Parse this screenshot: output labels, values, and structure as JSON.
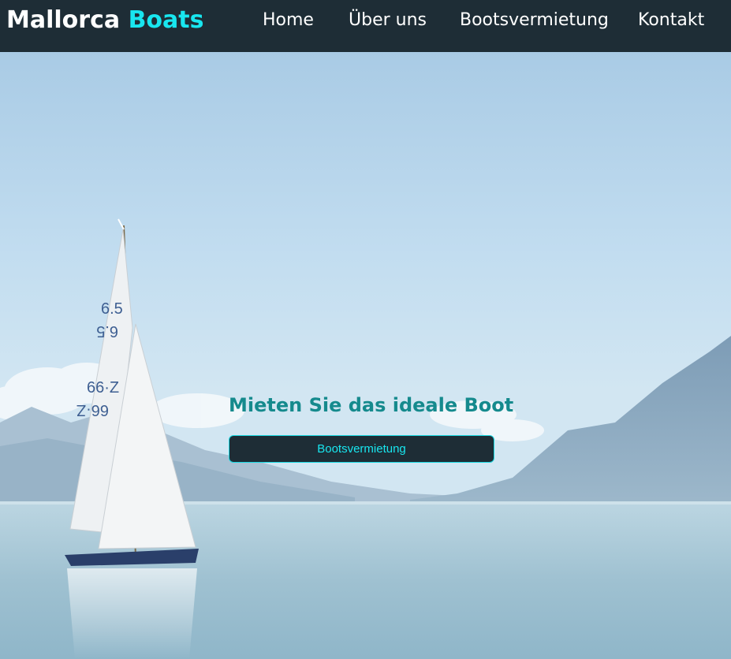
{
  "brand": {
    "word1": "Mallorca",
    "word2": "Boats"
  },
  "nav": [
    {
      "label": "Home"
    },
    {
      "label": "Über uns"
    },
    {
      "label": "Bootsvermietung"
    },
    {
      "label": "Kontakt"
    }
  ],
  "hero": {
    "headline": "Mieten Sie das ideale Boot",
    "button_label": "Bootsvermietung",
    "sail_numbers": [
      "6.5",
      "6.5",
      "66·Z",
      "66·Z"
    ]
  },
  "colors": {
    "navbar_bg": "#1e2d36",
    "accent": "#18e6ef",
    "headline": "#158a8d"
  }
}
